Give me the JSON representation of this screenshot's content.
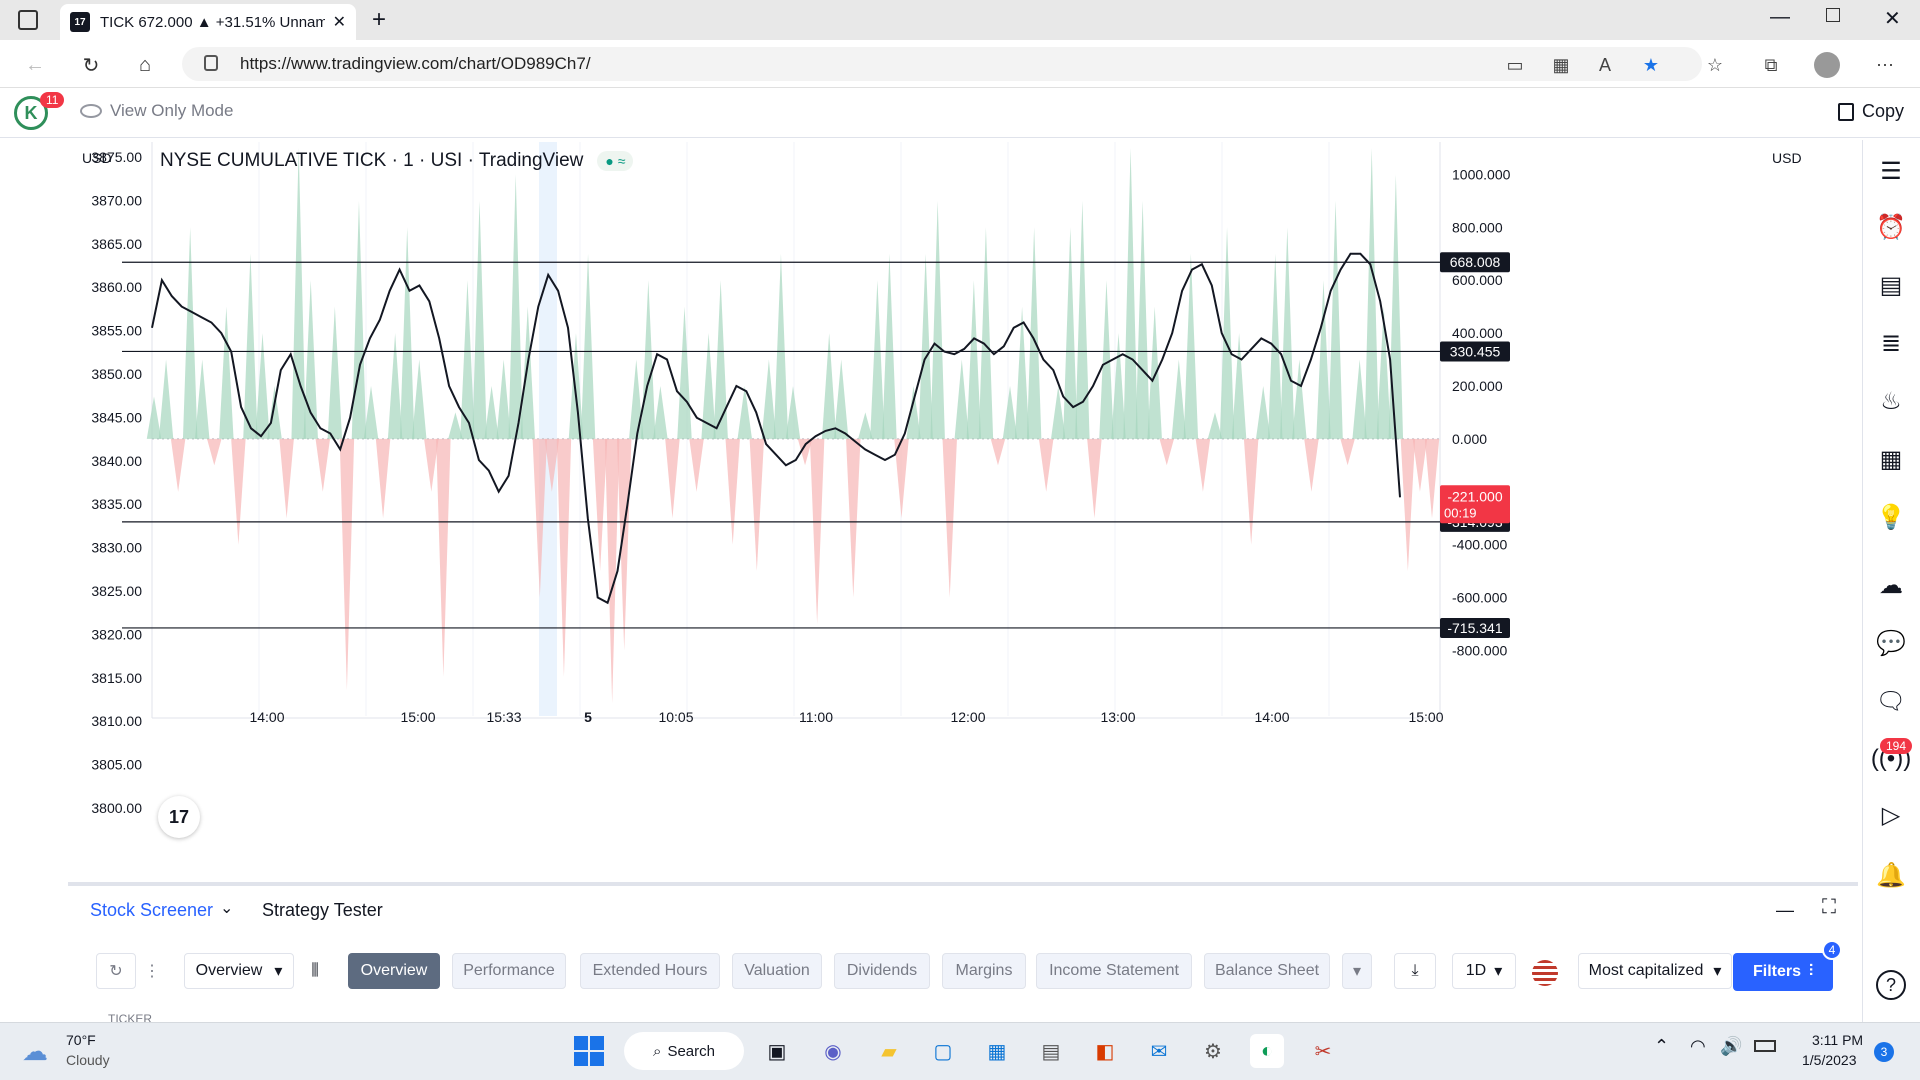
{
  "browser": {
    "tab_title": "TICK 672.000 ▲ +31.51% Unnam",
    "tab_logo": "17",
    "url": "https://www.tradingview.com/chart/OD989Ch7/"
  },
  "header": {
    "avatar_letter": "K",
    "notifications": "11",
    "view_only": "View Only Mode",
    "copy": "Copy"
  },
  "chart": {
    "legend": "NYSE CUMULATIVE TICK · 1 · USI · TradingView",
    "legend_dots": "● ≈",
    "left_currency": "USD",
    "right_currency": "USD",
    "left_ticks": [
      "3875.00",
      "3870.00",
      "3865.00",
      "3860.00",
      "3855.00",
      "3850.00",
      "3845.00",
      "3840.00",
      "3835.00",
      "3830.00",
      "3825.00",
      "3820.00",
      "3815.00",
      "3810.00",
      "3805.00",
      "3800.00"
    ],
    "right_ticks": [
      "1000.000",
      "800.000",
      "600.000",
      "400.000",
      "200.000",
      "0.000",
      "-400.000",
      "-600.000",
      "-800.000"
    ],
    "x_ticks": [
      "14:00",
      "15:00",
      "15:33",
      "5",
      "10:05",
      "11:00",
      "12:00",
      "13:00",
      "14:00",
      "15:00"
    ],
    "price_labels": [
      {
        "value": 668.008,
        "text": "668.008"
      },
      {
        "value": 330.455,
        "text": "330.455"
      },
      {
        "value": -314.093,
        "text": "-314.093"
      },
      {
        "value": -715.341,
        "text": "-715.341"
      }
    ],
    "last_label": {
      "value": -221.0,
      "text": "-221.000",
      "countdown": "00:19"
    },
    "tv_logo": "17",
    "colors": {
      "positive_fill": "#a5d6bd",
      "negative_fill": "#f7b5b5",
      "line": "#131722",
      "last": "#f23645"
    }
  },
  "chart_data": {
    "type": "area",
    "title": "NYSE CUMULATIVE TICK · 1 · USI · TradingView",
    "x_tick_labels": [
      "14:00",
      "15:00",
      "15:33",
      "5",
      "10:05",
      "11:00",
      "12:00",
      "13:00",
      "14:00",
      "15:00"
    ],
    "ylim": [
      -950,
      1100
    ],
    "levels": [
      668.008,
      330.455,
      -314.093,
      -715.341
    ],
    "last_value": -221.0,
    "tick_values": [
      160,
      300,
      -200,
      800,
      300,
      -100,
      500,
      -400,
      700,
      400,
      200,
      -300,
      1100,
      600,
      -200,
      500,
      -950,
      900,
      200,
      -300,
      400,
      800,
      300,
      -200,
      -900,
      100,
      600,
      900,
      200,
      300,
      1000,
      500,
      -600,
      -200,
      -900,
      400,
      700,
      -500,
      -1000,
      -800,
      300,
      600,
      200,
      -300,
      500,
      -200,
      400,
      600,
      -400,
      200,
      -500,
      300,
      700,
      200,
      -100,
      -700,
      400,
      300,
      -600,
      100,
      600,
      700,
      -300,
      200,
      700,
      900,
      -600,
      300,
      600,
      800,
      -100,
      200,
      500,
      800,
      -200,
      200,
      800,
      900,
      -300,
      600,
      400,
      1100,
      900,
      500,
      -100,
      300,
      700,
      -200,
      100,
      800,
      400,
      -400,
      200,
      700,
      800,
      300,
      -200,
      600,
      900,
      -100,
      300,
      1100,
      500,
      1000,
      -500,
      -200,
      -300
    ],
    "series": [
      {
        "values": [
          420,
          600,
          540,
          500,
          480,
          460,
          440,
          400,
          330,
          120,
          40,
          10,
          60,
          260,
          320,
          200,
          100,
          40,
          20,
          -40,
          80,
          280,
          380,
          450,
          560,
          640,
          560,
          580,
          520,
          380,
          200,
          120,
          60,
          -80,
          -120,
          -200,
          -140,
          60,
          300,
          500,
          620,
          560,
          420,
          100,
          -300,
          -600,
          -620,
          -500,
          -250,
          20,
          200,
          320,
          300,
          180,
          140,
          80,
          60,
          40,
          120,
          200,
          180,
          100,
          -20,
          -60,
          -100,
          -80,
          -20,
          10,
          30,
          40,
          20,
          -10,
          -40,
          -60,
          -80,
          -60,
          20,
          160,
          300,
          360,
          330,
          320,
          340,
          380,
          360,
          320,
          350,
          420,
          440,
          380,
          300,
          260,
          160,
          120,
          140,
          200,
          280,
          300,
          320,
          300,
          260,
          220,
          300,
          400,
          560,
          640,
          660,
          580,
          400,
          320,
          300,
          340,
          380,
          360,
          320,
          220,
          200,
          300,
          420,
          560,
          640,
          700,
          700,
          660,
          520,
          300,
          -221
        ]
      }
    ]
  },
  "panel": {
    "tab_screener": "Stock Screener",
    "tab_strategy": "Strategy Tester",
    "overview_select": "Overview",
    "filters": [
      "Overview",
      "Performance",
      "Extended Hours",
      "Valuation",
      "Dividends",
      "Margins",
      "Income Statement",
      "Balance Sheet"
    ],
    "timeframe": "1D",
    "universe": "Most capitalized",
    "filters_btn": "Filters",
    "filters_count": "4",
    "column_ticker": "TICKER"
  },
  "right_toolbar": {
    "badge": "194"
  },
  "taskbar": {
    "weather_temp": "70°F",
    "weather_desc": "Cloudy",
    "search": "Search",
    "time": "3:11 PM",
    "date": "1/5/2023",
    "notif_count": "3"
  }
}
